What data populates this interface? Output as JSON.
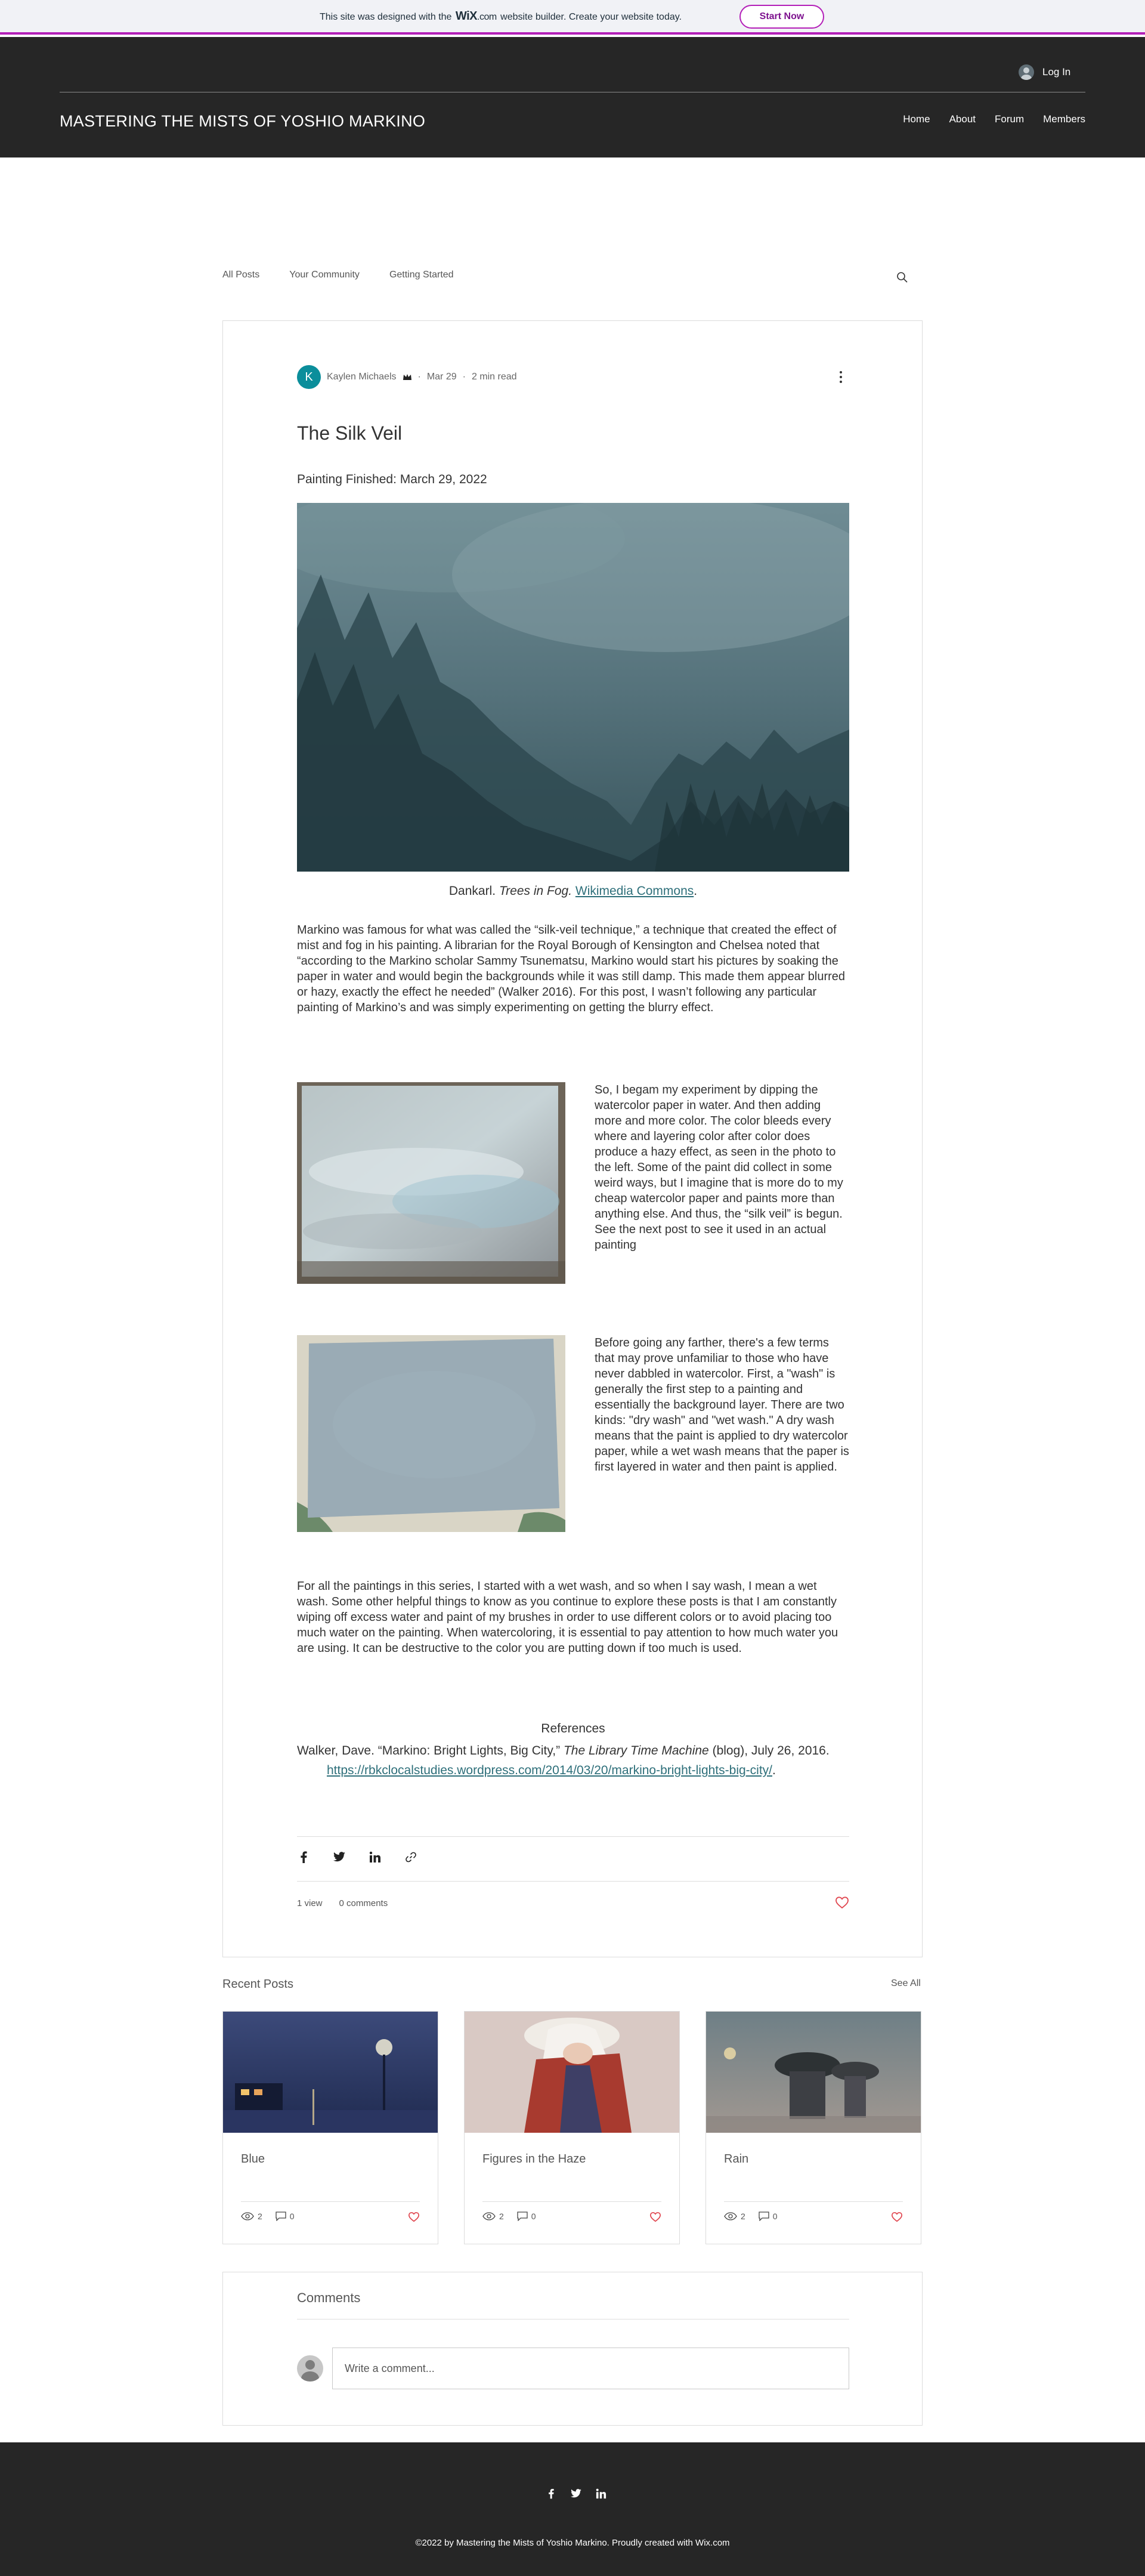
{
  "banner": {
    "text_before": "This site was designed with the",
    "logo": "WiX",
    "logo_suffix": ".com",
    "text_after": "website builder. Create your website today.",
    "cta": "Start Now"
  },
  "header": {
    "login_label": "Log In",
    "site_title": "MASTERING THE MISTS OF YOSHIO MARKINO",
    "nav": [
      "Home",
      "About",
      "Forum",
      "Members"
    ]
  },
  "categories": [
    "All Posts",
    "Your Community",
    "Getting Started"
  ],
  "post": {
    "author_initial": "K",
    "author": "Kaylen Michaels",
    "date": "Mar 29",
    "read_time": "2 min read",
    "title": "The Silk Veil",
    "finished": "Painting Finished: March 29, 2022",
    "caption": {
      "credit": "Dankarl.",
      "work": "Trees in Fog.",
      "link": "Wikimedia Commons",
      "end": "."
    },
    "paragraph1": "Markino was famous for what was called the “silk-veil technique,” a technique that created the effect of mist and fog in his painting. A librarian for the Royal Borough of Kensington and Chelsea noted that “according to the Markino scholar Sammy Tsunematsu,  Markino would start his pictures by soaking the paper in water and would begin the backgrounds while it was still damp. This made them appear blurred or hazy, exactly the effect he needed” (Walker 2016). For this post, I wasn’t following any particular painting of Markino’s and was simply experimenting on getting the blurry effect.",
    "side1": "So, I begam my experiment by dipping the watercolor paper in water. And then adding more and more color. The color bleeds every where and layering color after color does produce a hazy effect, as seen in the photo to the left. Some of the paint did collect in some weird ways, but I imagine that is more do to my cheap watercolor paper and paints more than anything else. And thus, the “silk veil” is begun. See the next post to see it used in an actual painting",
    "side2": "Before going any farther, there's a few terms that may prove unfamiliar to those who have never dabbled in watercolor. First, a \"wash\" is generally the first step to a painting and essentially the background layer. There are two kinds: \"dry wash\" and \"wet wash.\" A dry wash means that the paint is applied to dry watercolor paper, while a wet wash means that the paper is first layered in water and then paint is applied.",
    "paragraph4": "For all the paintings in this series, I started with a wet wash, and so when I say wash, I mean a wet wash. Some other helpful things to know as you continue to explore these posts is that I am constantly wiping off excess water and paint of my brushes in order to use different colors or to avoid placing too much water on the painting. When watercoloring, it is essential to pay attention to how much water you are using. It can be destructive to the color you are putting down if too much is used.",
    "references_heading": "References",
    "reference": {
      "before": "Walker, Dave. “Markino: Bright Lights, Big City,”",
      "italic": "The Library Time Machine",
      "after": "(blog), July 26, 2016.",
      "link": "https://rbkclocalstudies.wordpress.com/2014/03/20/markino-bright-lights-big-city/",
      "end": "."
    },
    "views": "1 view",
    "comments": "0 comments"
  },
  "recent": {
    "title": "Recent Posts",
    "see_all": "See All",
    "posts": [
      {
        "title": "Blue",
        "views": "2",
        "comments": "0"
      },
      {
        "title": "Figures in the Haze",
        "views": "2",
        "comments": "0"
      },
      {
        "title": "Rain",
        "views": "2",
        "comments": "0"
      }
    ]
  },
  "comments_section": {
    "title": "Comments",
    "placeholder": "Write a comment..."
  },
  "footer": {
    "copyright": "©2022 by Mastering the Mists of Yoshio Markino. Proudly created with Wix.com"
  },
  "colors": {
    "wix_accent": "#b31fb8",
    "header_bg": "#262626",
    "avatar_teal": "#0b8e9b",
    "heart_red": "#e0444d"
  }
}
